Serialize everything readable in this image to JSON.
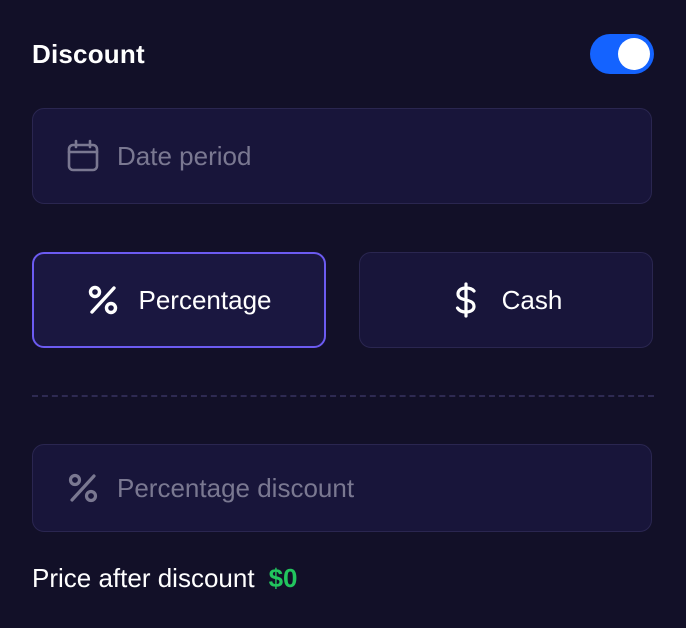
{
  "header": {
    "title": "Discount",
    "toggle_on": true,
    "toggle_color": "#1463ff"
  },
  "date_field": {
    "icon": "calendar-icon",
    "placeholder": "Date period",
    "value": ""
  },
  "discount_type": {
    "options": [
      {
        "label": "Percentage",
        "icon": "percent-icon",
        "selected": true
      },
      {
        "label": "Cash",
        "icon": "dollar-icon",
        "selected": false
      }
    ],
    "selected_border_color": "#6c5bf1"
  },
  "discount_field": {
    "icon": "percent-icon",
    "placeholder": "Percentage discount",
    "value": ""
  },
  "price": {
    "label": "Price after discount",
    "value": "$0",
    "value_color": "#22c55e"
  },
  "colors": {
    "background": "#121028",
    "field_background": "#18153a",
    "field_border": "#2a2650",
    "placeholder": "#7a7891"
  }
}
